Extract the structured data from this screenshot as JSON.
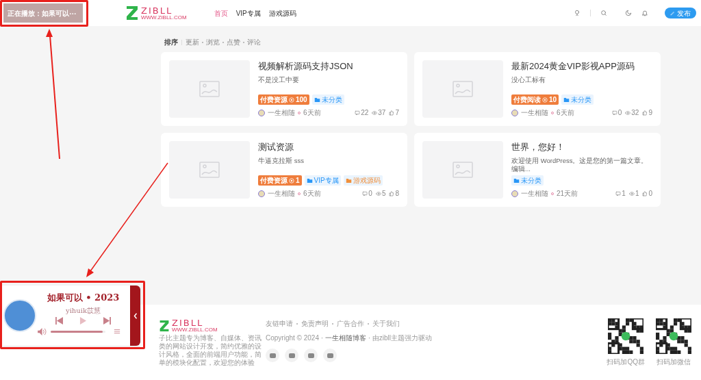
{
  "now_playing": {
    "text": "正在播放：如果可以···"
  },
  "header": {
    "logo": "ZIBLL",
    "logo_sub": "WWW.ZIBLL.COM",
    "nav": [
      {
        "label": "首页",
        "selected": true
      },
      {
        "label": "VIP专属",
        "selected": false
      },
      {
        "label": "游戏源码",
        "selected": false
      }
    ],
    "publish_button": "发布"
  },
  "sort_bar": {
    "label": "排序",
    "options": [
      "更新",
      "浏览",
      "点赞",
      "评论"
    ]
  },
  "posts": [
    {
      "title": "视频解析源码支持JSON",
      "excerpt": "不是没工中要",
      "tags": [
        {
          "kind": "paid",
          "label": "付费资源",
          "points": "100"
        },
        {
          "kind": "category",
          "label": "未分类",
          "color": "#2997f7"
        }
      ],
      "author": "一生相随",
      "time": "6天前",
      "comments": "22",
      "views": "37",
      "likes": "7"
    },
    {
      "title": "最新2024黄金VIP影视APP源码",
      "excerpt": "没心工标有",
      "tags": [
        {
          "kind": "paid",
          "label": "付费阅读",
          "points": "10"
        },
        {
          "kind": "category",
          "label": "未分类",
          "color": "#2997f7"
        }
      ],
      "author": "一生相随",
      "time": "6天前",
      "comments": "0",
      "views": "32",
      "likes": "9"
    },
    {
      "title": "测试资源",
      "excerpt": "牛逼克拉斯 sss",
      "tags": [
        {
          "kind": "paid",
          "label": "付费资源",
          "points": "1"
        },
        {
          "kind": "category",
          "label": "VIP专属",
          "color": "#2997f7"
        },
        {
          "kind": "category",
          "label": "游戏源码",
          "color": "#f0903c"
        }
      ],
      "author": "一生相随",
      "time": "6天前",
      "comments": "0",
      "views": "5",
      "likes": "8"
    },
    {
      "title": "世界，您好！",
      "excerpt": "欢迎使用 WordPress。这是您的第一篇文章。编辑...",
      "tags": [
        {
          "kind": "category",
          "label": "未分类",
          "color": "#2997f7"
        }
      ],
      "author": "一生相随",
      "time": "21天前",
      "comments": "1",
      "views": "1",
      "likes": "0"
    }
  ],
  "footer": {
    "logo": "ZIBLL",
    "logo_sub": "WWW.ZIBLL.COM",
    "description": "子比主题专为博客、自媒体、资讯类的网站设计开发，简约优雅的设计风格，全面的前端用户功能，简单的模块化配置，欢迎您的体验",
    "links": [
      "友链申请",
      "免责声明",
      "广告合作",
      "关于我们"
    ],
    "copyright": "Copyright © 2024 · ",
    "site_link": "一生相随博客",
    "powered": " · 由zibll主题强力驱动",
    "qr_codes": [
      {
        "caption": "扫码加QQ群"
      },
      {
        "caption": "扫码加微信"
      }
    ]
  },
  "player": {
    "title": "如果可以 • 2023",
    "artist": "yihuik苡慧",
    "volume": {
      "level": 0.95
    }
  }
}
